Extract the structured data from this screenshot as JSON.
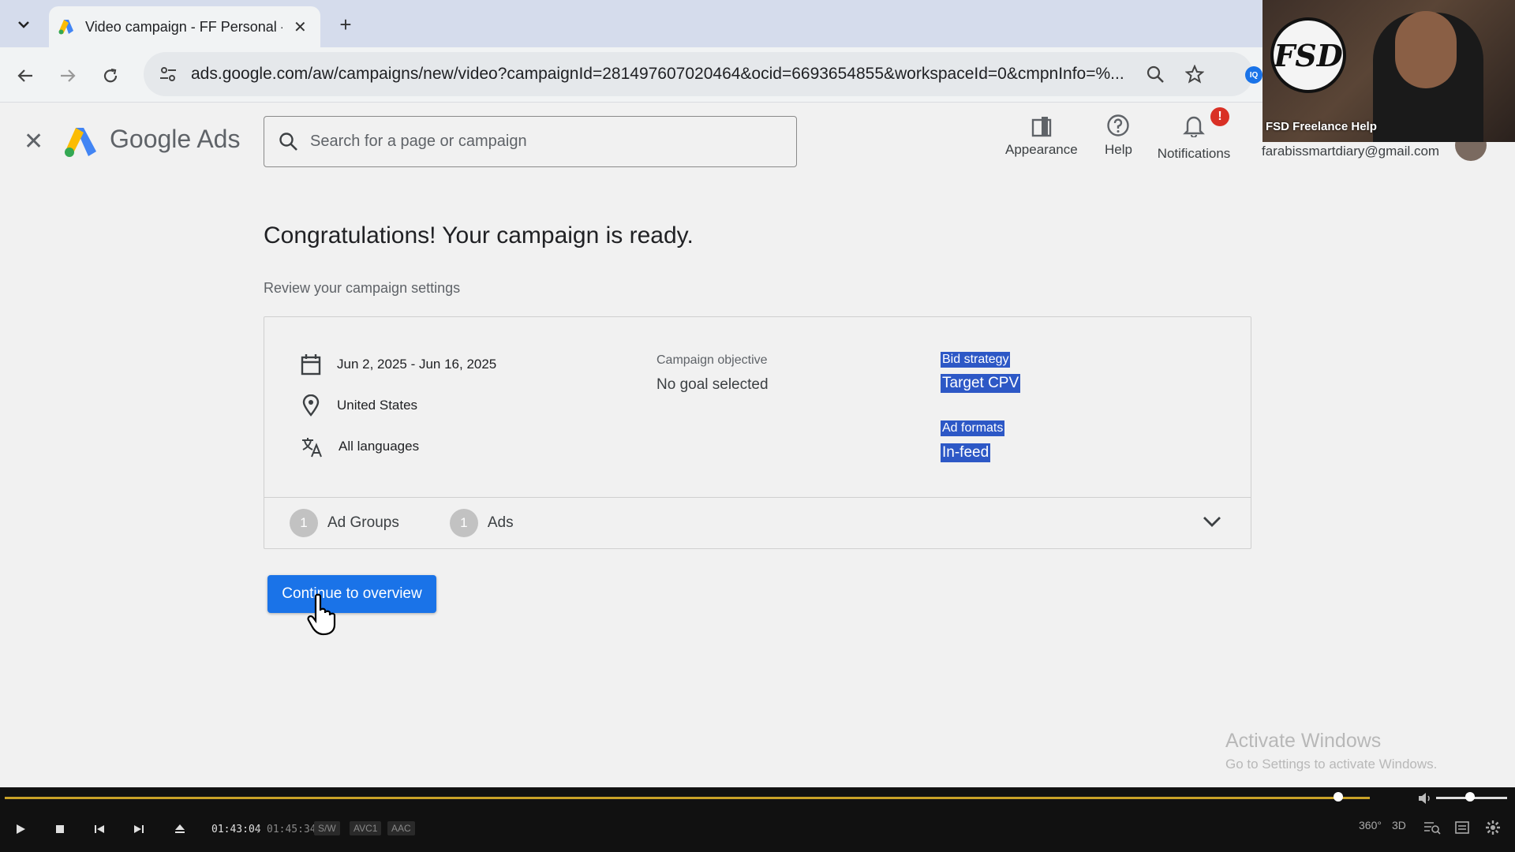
{
  "browser": {
    "tab_title": "Video campaign - FF Personal -",
    "tab_close": "✕",
    "new_tab": "+",
    "url": "ads.google.com/aw/campaigns/new/video?campaignId=281497607020464&ocid=6693654855&workspaceId=0&cmpnInfo=%...",
    "extension_badge": "IQ"
  },
  "ads_header": {
    "brand": "Google Ads",
    "search_placeholder": "Search for a page or campaign",
    "actions": {
      "appearance": "Appearance",
      "help": "Help",
      "notifications": "Notifications"
    },
    "notification_badge": "!",
    "account_email": "farabissmartdiary@gmail.com"
  },
  "webcam": {
    "logo_text": "FSD",
    "label": "FSD Freelance Help"
  },
  "main": {
    "headline": "Congratulations! Your campaign is ready.",
    "subheading": "Review your campaign settings",
    "details": {
      "dates": "Jun 2, 2025 - Jun 16, 2025",
      "location": "United States",
      "languages": "All languages"
    },
    "objective": {
      "label": "Campaign objective",
      "value": "No goal selected"
    },
    "bid_strategy": {
      "label": "Bid strategy",
      "value": "Target CPV"
    },
    "ad_formats": {
      "label": "Ad formats",
      "value": "In-feed"
    },
    "footer": {
      "ad_groups_count": "1",
      "ad_groups_label": "Ad Groups",
      "ads_count": "1",
      "ads_label": "Ads"
    },
    "continue_button": "Continue to overview"
  },
  "watermark": {
    "title": "Activate Windows",
    "subtitle": "Go to Settings to activate Windows."
  },
  "player": {
    "current_time": "01:43:04",
    "separator": "/",
    "total_time": "01:45:34",
    "tags": [
      "S/W",
      "AVC1",
      "AAC"
    ],
    "right_icons": [
      "360°",
      "3D"
    ],
    "progress": 0.977,
    "volume": 0.48
  },
  "colors": {
    "accent": "#1a73e8",
    "selection": "#2d58c6",
    "badge": "#d93025"
  }
}
